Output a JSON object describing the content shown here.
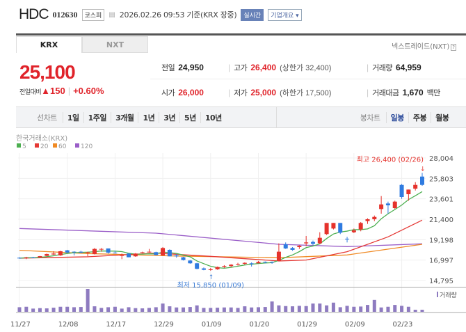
{
  "header": {
    "name": "HDC",
    "code": "012630",
    "market_badge": "코스피",
    "datetime": "2026.02.26 09:53",
    "basis": "기준(KRX 장중)",
    "realtime_badge": "실시간",
    "company_button": "기업개요 ▾"
  },
  "tabs": [
    {
      "label": "KRX",
      "active": true
    },
    {
      "label": "NXT",
      "active": false
    }
  ],
  "nxt_link": "넥스트레이드(NXT)",
  "nxt_help": "?",
  "price": {
    "current": "25,100",
    "change_label": "전일대비",
    "change_arrow": "▲",
    "change": "150",
    "change_pct": "+0.60%"
  },
  "quote": {
    "prev_label": "전일",
    "prev": "24,950",
    "high_label": "고가",
    "high": "26,400",
    "upper_limit": "(상한가 32,400)",
    "volume_label": "거래량",
    "volume": "64,959",
    "open_label": "시가",
    "open": "26,000",
    "low_label": "저가",
    "low": "25,000",
    "lower_limit": "(하한가 17,500)",
    "value_label": "거래대금",
    "value": "1,670",
    "value_unit": "백만"
  },
  "periods": {
    "line_label": "선차트",
    "line_items": [
      "1일",
      "1주일",
      "3개월",
      "1년",
      "3년",
      "5년",
      "10년"
    ],
    "candle_label": "봉차트",
    "candle_items": [
      "일봉",
      "주봉",
      "월봉"
    ],
    "active_candle": "일봉"
  },
  "chart_data": {
    "type": "candlestick",
    "title": "한국거래소(KRX)",
    "legend": [
      {
        "name": "5",
        "color": "#4caf50"
      },
      {
        "name": "20",
        "color": "#e53935"
      },
      {
        "name": "60",
        "color": "#f08a24"
      },
      {
        "name": "120",
        "color": "#9a5ec8"
      }
    ],
    "up_color": "#e5322c",
    "down_color": "#2f7be0",
    "ylim": [
      14795,
      28004
    ],
    "yticks": [
      "28,004",
      "25,803",
      "23,601",
      "21,400",
      "19,198",
      "16,997",
      "14,795"
    ],
    "ytick_values": [
      28004,
      25803,
      23601,
      21400,
      19198,
      16997,
      14795
    ],
    "xticks": [
      {
        "label": "11/27",
        "index": 0
      },
      {
        "label": "12/08",
        "index": 7
      },
      {
        "label": "12/17",
        "index": 14
      },
      {
        "label": "12/29",
        "index": 21
      },
      {
        "label": "01/09",
        "index": 28
      },
      {
        "label": "01/20",
        "index": 35
      },
      {
        "label": "01/29",
        "index": 42
      },
      {
        "label": "02/09",
        "index": 49
      },
      {
        "label": "02/23",
        "index": 56
      }
    ],
    "ohlc": [
      [
        17250,
        17300,
        17150,
        17200
      ],
      [
        17250,
        17350,
        17100,
        17300
      ],
      [
        17300,
        17350,
        17200,
        17250
      ],
      [
        17300,
        17450,
        17250,
        17420
      ],
      [
        17450,
        17700,
        17400,
        17650
      ],
      [
        17600,
        17950,
        17550,
        17700
      ],
      [
        17500,
        18000,
        17450,
        17950
      ],
      [
        18050,
        18100,
        17750,
        17800
      ],
      [
        17900,
        17950,
        17500,
        17850
      ],
      [
        17900,
        18000,
        17750,
        17800
      ],
      [
        17800,
        17900,
        17400,
        17850
      ],
      [
        17650,
        18300,
        17600,
        18200
      ],
      [
        18150,
        18300,
        17900,
        18200
      ],
      [
        18250,
        18250,
        17700,
        17800
      ],
      [
        17800,
        18000,
        17700,
        17750
      ],
      [
        17450,
        17700,
        17100,
        17600
      ],
      [
        17700,
        17750,
        17300,
        17300
      ],
      [
        17400,
        17750,
        17350,
        17700
      ],
      [
        17800,
        17900,
        17750,
        17850
      ],
      [
        17850,
        18200,
        17800,
        17900
      ],
      [
        17850,
        17900,
        17500,
        17550
      ],
      [
        17500,
        18400,
        17450,
        18300
      ],
      [
        18100,
        18150,
        17400,
        17400
      ],
      [
        17500,
        17650,
        17250,
        17400
      ],
      [
        17300,
        17350,
        16950,
        17000
      ],
      [
        16950,
        17000,
        16600,
        16650
      ],
      [
        16650,
        16700,
        16000,
        16050
      ],
      [
        16100,
        16200,
        15900,
        15950
      ],
      [
        15950,
        16150,
        15850,
        16000
      ],
      [
        16000,
        16300,
        15950,
        16250
      ],
      [
        16250,
        16450,
        16150,
        16350
      ],
      [
        16350,
        16550,
        16250,
        16500
      ],
      [
        16550,
        16700,
        16400,
        16550
      ],
      [
        16600,
        16750,
        16500,
        16700
      ],
      [
        16650,
        16750,
        16300,
        16600
      ],
      [
        16650,
        16900,
        16650,
        16800
      ],
      [
        16800,
        16850,
        16650,
        16750
      ],
      [
        16800,
        16850,
        16600,
        16750
      ],
      [
        16900,
        18800,
        16900,
        17900
      ],
      [
        18700,
        18900,
        18200,
        18250
      ],
      [
        18300,
        18400,
        18000,
        18100
      ],
      [
        18400,
        18600,
        18200,
        18550
      ],
      [
        18800,
        19600,
        18500,
        18900
      ],
      [
        18950,
        19100,
        18600,
        18750
      ],
      [
        18800,
        20000,
        18700,
        19400
      ],
      [
        19800,
        21000,
        19700,
        21000
      ],
      [
        20400,
        21000,
        20300,
        21000
      ],
      [
        21000,
        21000,
        19800,
        19950
      ],
      [
        19300,
        19500,
        18900,
        19250
      ],
      [
        20000,
        20400,
        19900,
        20200
      ],
      [
        20300,
        21100,
        20100,
        21000
      ],
      [
        21200,
        21500,
        20900,
        21400
      ],
      [
        21400,
        21800,
        21200,
        21650
      ],
      [
        22500,
        23900,
        22000,
        23000
      ],
      [
        23100,
        23300,
        22000,
        22900
      ],
      [
        22600,
        23400,
        22500,
        23300
      ],
      [
        25100,
        25200,
        23600,
        23800
      ],
      [
        24100,
        24600,
        23400,
        24600
      ],
      [
        24700,
        25400,
        24500,
        25100
      ],
      [
        26000,
        26400,
        25000,
        25100
      ]
    ],
    "ma20_points": [
      [
        0,
        17200
      ],
      [
        10,
        17350
      ],
      [
        20,
        17750
      ],
      [
        28,
        17400
      ],
      [
        38,
        16900
      ],
      [
        42,
        17000
      ],
      [
        48,
        17900
      ],
      [
        54,
        19500
      ],
      [
        59,
        21300
      ]
    ],
    "ma60_points": [
      [
        0,
        18050
      ],
      [
        10,
        17700
      ],
      [
        22,
        17450
      ],
      [
        38,
        17250
      ],
      [
        48,
        17550
      ],
      [
        59,
        18700
      ]
    ],
    "ma120_points": [
      [
        0,
        20400
      ],
      [
        20,
        19900
      ],
      [
        38,
        18700
      ],
      [
        48,
        18450
      ],
      [
        59,
        18750
      ]
    ],
    "volume_label": "거래량",
    "volume": [
      20,
      22,
      14,
      16,
      15,
      18,
      22,
      22,
      20,
      21,
      100,
      24,
      17,
      20,
      22,
      14,
      20,
      16,
      15,
      17,
      20,
      36,
      24,
      19,
      19,
      21,
      28,
      17,
      17,
      18,
      19,
      19,
      17,
      24,
      19,
      20,
      21,
      45,
      28,
      25,
      24,
      26,
      25,
      36,
      36,
      28,
      40,
      20,
      26,
      22,
      23,
      30,
      52,
      19,
      22,
      30,
      26,
      22,
      9,
      9
    ],
    "annotations": [
      {
        "label": "최고 26,400 (02/26)",
        "index": 59,
        "value": 26400,
        "color": "#e5322c"
      },
      {
        "label": "최저 15,850 (01/09)",
        "index": 28,
        "value": 15850,
        "color": "#3a7bd5"
      }
    ]
  }
}
